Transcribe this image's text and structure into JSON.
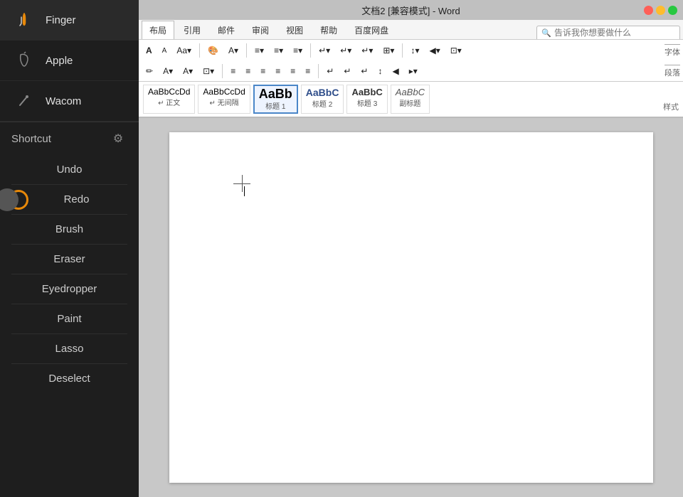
{
  "sidebar": {
    "tools": [
      {
        "id": "finger",
        "label": "Finger",
        "icon": "✋"
      },
      {
        "id": "apple",
        "label": "Apple",
        "icon": "✏️"
      },
      {
        "id": "wacom",
        "label": "Wacom",
        "icon": "✒️"
      }
    ],
    "shortcut_section": {
      "label": "Shortcut",
      "gear_icon": "⚙"
    },
    "shortcuts": [
      {
        "id": "undo",
        "label": "Undo",
        "has_orange_dot": false,
        "has_gray_knob": false
      },
      {
        "id": "redo",
        "label": "Redo",
        "has_orange_dot": true,
        "has_gray_knob": true
      },
      {
        "id": "brush",
        "label": "Brush",
        "has_orange_dot": false,
        "has_gray_knob": false
      },
      {
        "id": "eraser",
        "label": "Eraser",
        "has_orange_dot": false,
        "has_gray_knob": false
      },
      {
        "id": "eyedropper",
        "label": "Eyedropper",
        "has_orange_dot": false,
        "has_gray_knob": false
      },
      {
        "id": "paint",
        "label": "Paint",
        "has_orange_dot": false,
        "has_gray_knob": false
      },
      {
        "id": "lasso",
        "label": "Lasso",
        "has_orange_dot": false,
        "has_gray_knob": false
      },
      {
        "id": "deselect",
        "label": "Deselect",
        "has_orange_dot": false,
        "has_gray_knob": false
      }
    ]
  },
  "word": {
    "title": "文档2 [兼容模式] - Word",
    "tabs": [
      "布局",
      "引用",
      "邮件",
      "审阅",
      "视图",
      "帮助",
      "百度网盘"
    ],
    "active_tab": "布局",
    "search_placeholder": "告诉我你想要做什么",
    "ribbon_row1_buttons": [
      "A",
      "A",
      "Aa▾",
      "🎨",
      "A▾",
      "≡▾",
      "≡▾",
      "≡▾",
      "↵▾",
      "↵▾",
      "↵▾",
      "⊞▾",
      "↕▾",
      "◀▾",
      "⊡▾"
    ],
    "ribbon_row2_buttons": [
      "✏",
      "A▾",
      "A▾",
      "⊡▾",
      "≡",
      "≡",
      "≡",
      "≡",
      "≡",
      "≡",
      "↵",
      "↵",
      "↵",
      "↕",
      "◀",
      "▸▾"
    ],
    "paragraph_label": "段落",
    "font_label": "字体",
    "styles_label": "样式",
    "styles": [
      {
        "id": "normal",
        "label": "AaBbCcDd",
        "sublabel": "↵ 正文"
      },
      {
        "id": "no_spacing",
        "label": "AaBbCcDd",
        "sublabel": "↵ 无间隔"
      },
      {
        "id": "h1",
        "label": "AaBb",
        "sublabel": "标题 1"
      },
      {
        "id": "h2",
        "label": "AaBbC",
        "sublabel": "标题 2"
      },
      {
        "id": "h3",
        "label": "AaBbC",
        "sublabel": "标题 3"
      },
      {
        "id": "subtitle",
        "label": "AaBbC",
        "sublabel": "副标题"
      }
    ]
  }
}
